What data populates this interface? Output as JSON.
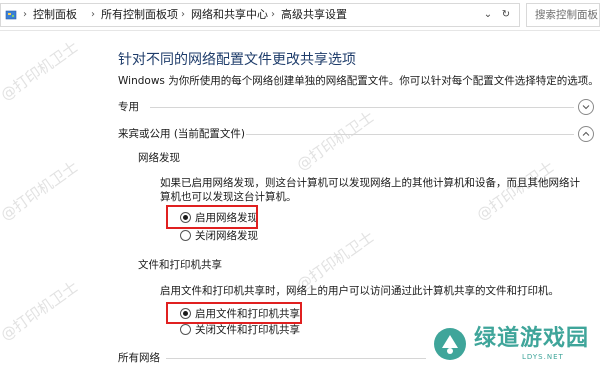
{
  "breadcrumb": {
    "items": [
      "控制面板",
      "所有控制面板项",
      "网络和共享中心",
      "高级共享设置"
    ]
  },
  "search": {
    "placeholder": "搜索控制面板"
  },
  "page": {
    "title": "针对不同的网络配置文件更改共享选项",
    "description": "Windows 为你所使用的每个网络创建单独的网络配置文件。你可以针对每个配置文件选择特定的选项。"
  },
  "profiles": {
    "private": {
      "label": "专用"
    },
    "guest": {
      "label": "来宾或公用 (当前配置文件)"
    },
    "all": {
      "label": "所有网络"
    }
  },
  "network_discovery": {
    "title": "网络发现",
    "description": "如果已启用网络发现，则这台计算机可以发现网络上的其他计算机和设备，而且其他网络计算机也可以发现这台计算机。",
    "options": [
      {
        "label": "启用网络发现",
        "checked": true
      },
      {
        "label": "关闭网络发现",
        "checked": false
      }
    ]
  },
  "file_printer_sharing": {
    "title": "文件和打印机共享",
    "description": "启用文件和打印机共享时，网络上的用户可以访问通过此计算机共享的文件和打印机。",
    "options": [
      {
        "label": "启用文件和打印机共享",
        "checked": true
      },
      {
        "label": "关闭文件和打印机共享",
        "checked": false
      }
    ]
  },
  "watermark": {
    "text": "@打印机卫士"
  },
  "logo": {
    "name": "绿道游戏园",
    "sub": "LDYS.NET"
  },
  "colors": {
    "title": "#1f3d6b",
    "highlight": "#e02020",
    "logo": "#3fa59a"
  }
}
